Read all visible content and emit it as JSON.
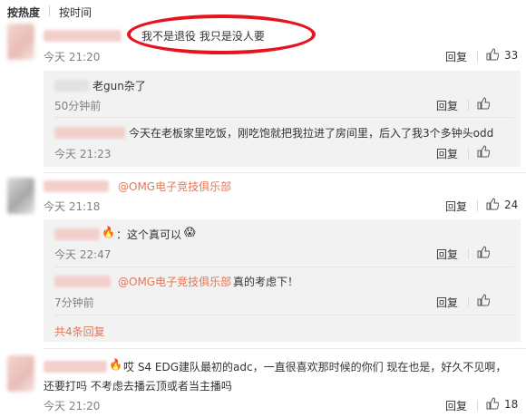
{
  "sort": {
    "hot_label": "按热度",
    "time_label": "按时间"
  },
  "actions": {
    "reply": "回复"
  },
  "comments": [
    {
      "text": "我不是退役 我只是没人要",
      "time": "今天 21:20",
      "likes": "33",
      "replies": [
        {
          "text": "老gun杂了",
          "time": "50分钟前"
        },
        {
          "text": "今天在老板家里吃饭，刚吃饱就把我拉进了房间里，后入了我3个多钟头odd",
          "time": "今天 21:23"
        }
      ]
    },
    {
      "mention": "@OMG电子竞技俱乐部",
      "time": "今天 21:18",
      "likes": "24",
      "replies": [
        {
          "text": "：这个真可以",
          "time": "今天 22:47"
        },
        {
          "mention": "@OMG电子竞技俱乐部",
          "text": " 真的考虑下！",
          "time": "7分钟前"
        }
      ],
      "more_replies": "共4条回复"
    },
    {
      "text_line1": "哎 S4 EDG建队最初的adc，一直很喜欢那时候的你们 现在也是，好久不见啊，",
      "text_line2": "还要打吗 不考虑去播云顶或者当主播吗",
      "time": "今天 21:20",
      "likes": "18"
    }
  ]
}
